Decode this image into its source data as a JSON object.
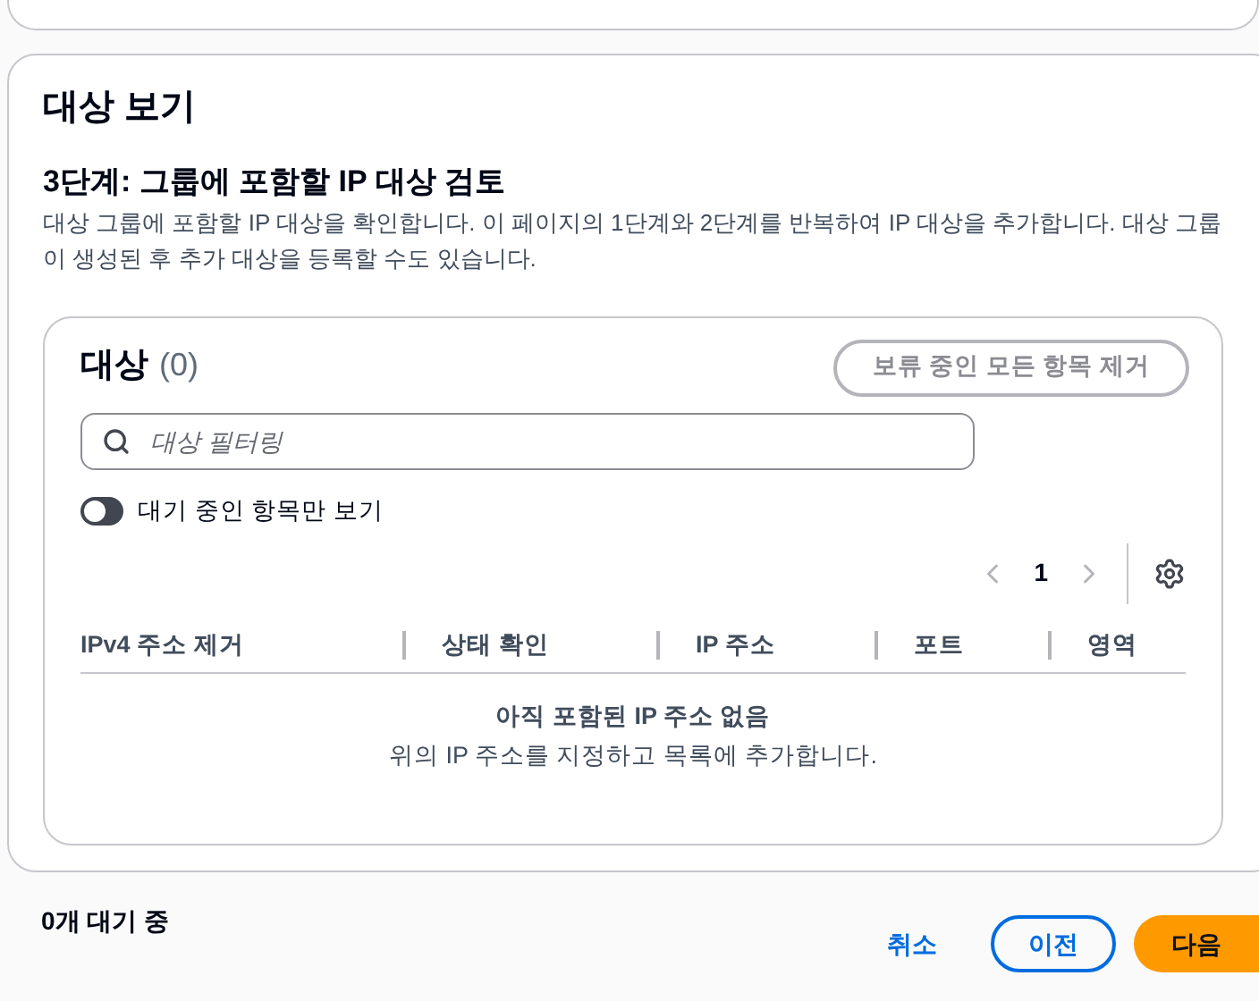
{
  "section": {
    "title": "대상 보기",
    "step_title": "3단계: 그룹에 포함할 IP 대상 검토",
    "description": "대상 그룹에 포함할 IP 대상을 확인합니다. 이 페이지의 1단계와 2단계를 반복하여 IP 대상을 추가합니다. 대상 그룹이 생성된 후 추가 대상을 등록할 수도 있습니다."
  },
  "targets": {
    "title": "대상",
    "count": "(0)",
    "remove_all_button": {
      "label": "보류 중인 모든 항목 제거",
      "disabled": true
    },
    "filter": {
      "placeholder": "대상 필터링"
    },
    "toggle": {
      "label": "대기 중인 항목만 보기",
      "on": false
    },
    "pagination": {
      "page": "1",
      "prev_disabled": true,
      "next_disabled": true
    },
    "columns": [
      "IPv4 주소 제거",
      "상태 확인",
      "IP 주소",
      "포트",
      "영역"
    ],
    "empty": {
      "title": "아직 포함된 IP 주소 없음",
      "message": "위의 IP 주소를 지정하고 목록에 추가합니다."
    }
  },
  "footer": {
    "pending": "0개 대기 중",
    "cancel": "취소",
    "previous": "이전",
    "next": "다음"
  }
}
